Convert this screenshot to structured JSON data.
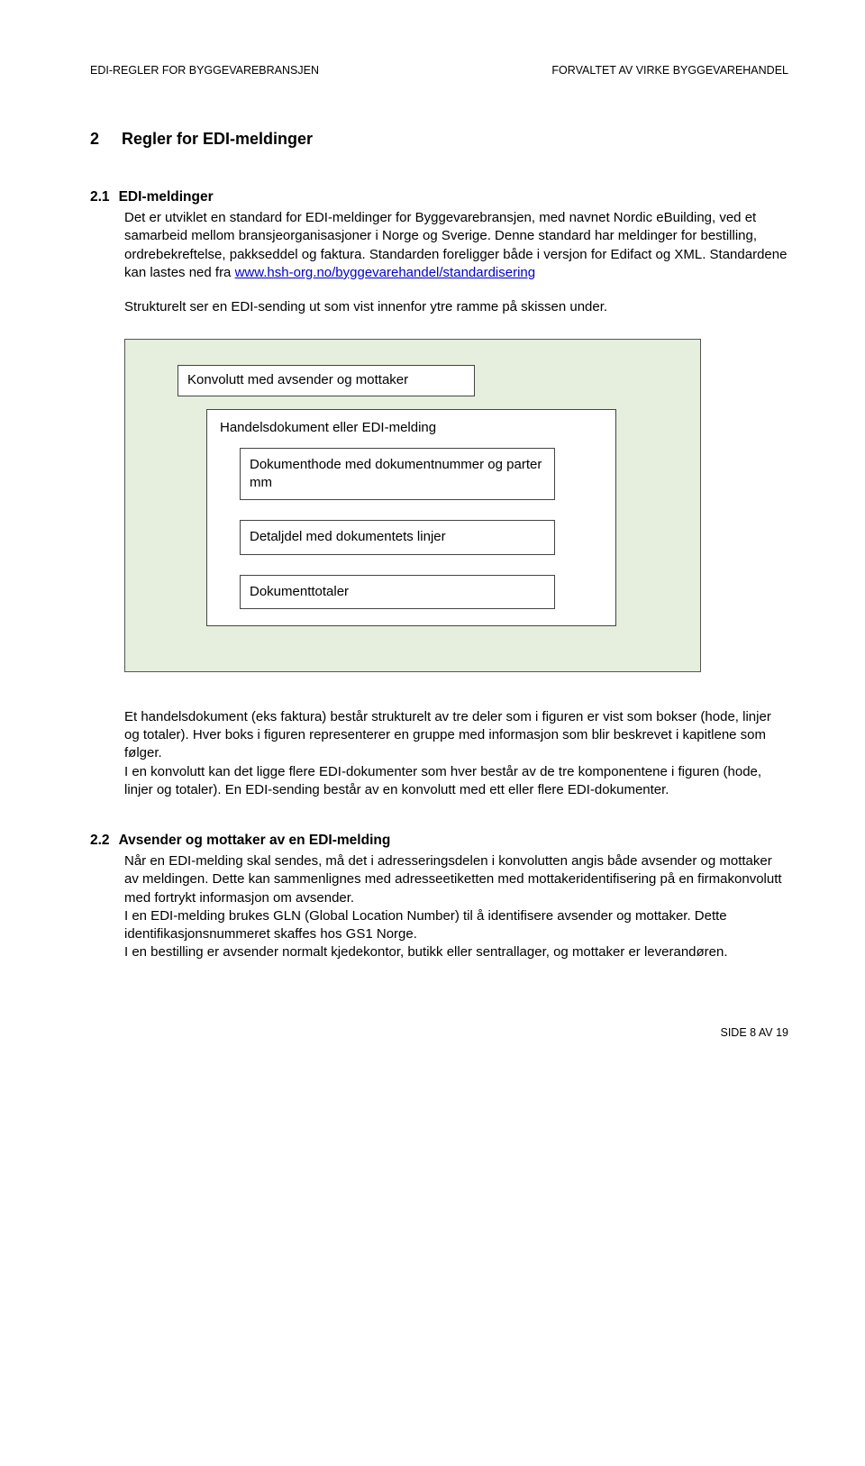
{
  "header": {
    "left": "EDI-REGLER FOR BYGGEVAREBRANSJEN",
    "right": "FORVALTET AV VIRKE  BYGGEVAREHANDEL"
  },
  "section2": {
    "num": "2",
    "title": "Regler for EDI-meldinger"
  },
  "section21": {
    "num": "2.1",
    "title": "EDI-meldinger",
    "p1": "Det er utviklet en standard for EDI-meldinger for Byggevarebransjen, med navnet Nordic eBuilding, ved et samarbeid mellom bransjeorganisasjoner i Norge og Sverige. Denne standard har meldinger for bestilling, ordrebekreftelse, pakkseddel og faktura. Standarden foreligger både i versjon for Edifact og XML. Standardene kan lastes ned fra ",
    "link": "www.hsh-org.no/byggevarehandel/standardisering",
    "p2": "Strukturelt ser en EDI-sending ut som vist innenfor ytre ramme på skissen under."
  },
  "diagram": {
    "konvolutt": "Konvolutt med avsender og mottaker",
    "handels": "Handelsdokument eller EDI-melding",
    "hode": "Dokumenthode med dokumentnummer og parter mm",
    "detalj": "Detaljdel med dokumentets linjer",
    "totaler": "Dokumenttotaler"
  },
  "section21b": {
    "p3": "Et handelsdokument (eks faktura) består strukturelt av tre deler som i figuren er vist som bokser (hode, linjer og totaler). Hver boks i figuren representerer en gruppe med informasjon som blir beskrevet i kapitlene som følger.",
    "p4": "I en konvolutt kan det ligge flere EDI-dokumenter som hver består av de tre komponentene i figuren (hode, linjer og totaler). En EDI-sending består av en konvolutt med ett eller flere EDI-dokumenter."
  },
  "section22": {
    "num": "2.2",
    "title": "Avsender og mottaker av en EDI-melding",
    "p1": "Når en EDI-melding skal sendes, må det i adresseringsdelen i konvolutten angis både avsender og mottaker av meldingen. Dette kan sammenlignes med adresseetiketten med mottakeridentifisering på en firmakonvolutt med fortrykt informasjon om avsender.",
    "p2": "I en EDI-melding brukes GLN (Global Location Number) til å identifisere avsender og mottaker. Dette identifikasjonsnummeret skaffes hos GS1 Norge.",
    "p3": "I en bestilling er avsender normalt kjedekontor, butikk eller sentrallager, og mottaker er leverandøren."
  },
  "footer": {
    "text": "SIDE 8 AV 19"
  }
}
